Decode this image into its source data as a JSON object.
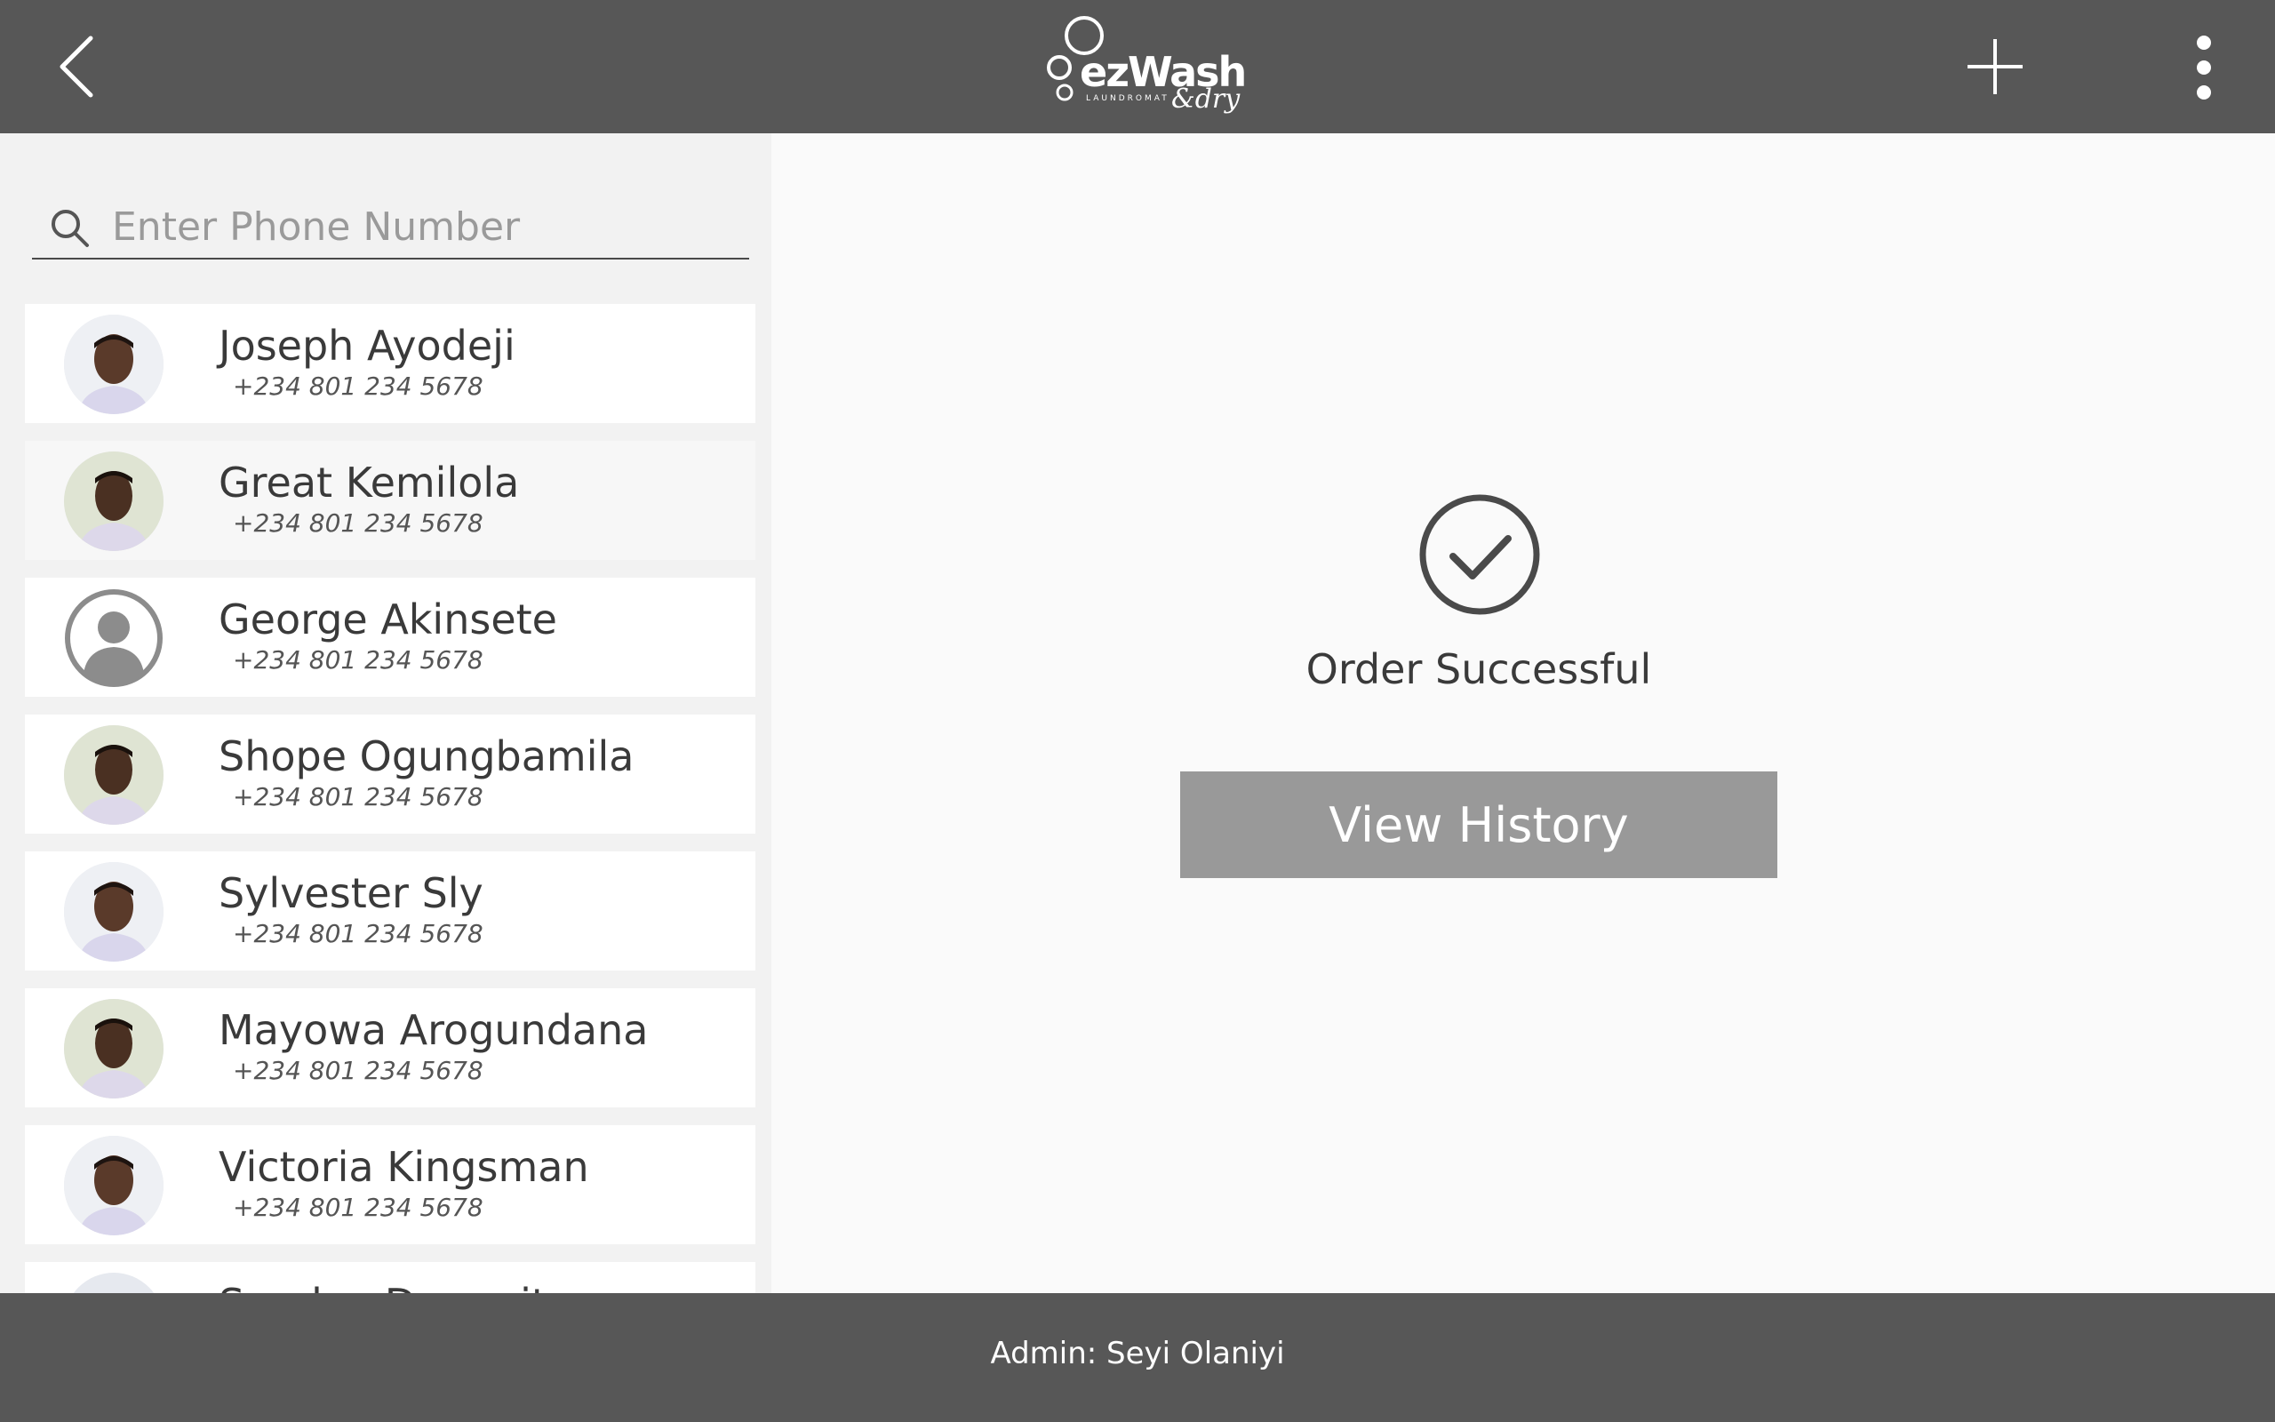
{
  "header": {
    "logo_text": "ezWash",
    "logo_subtext": "LAUNDROMAT",
    "logo_script": "&dry"
  },
  "search": {
    "placeholder": "Enter Phone Number",
    "value": ""
  },
  "customers": [
    {
      "name": "Joseph Ayodeji",
      "phone": "+234 801 234 5678",
      "avatar": "photo"
    },
    {
      "name": "Great Kemilola",
      "phone": "+234 801 234 5678",
      "avatar": "photo"
    },
    {
      "name": "George Akinsete",
      "phone": "+234 801 234 5678",
      "avatar": "default-user-icon"
    },
    {
      "name": "Shope Ogungbamila",
      "phone": "+234 801 234 5678",
      "avatar": "photo"
    },
    {
      "name": "Sylvester Sly",
      "phone": "+234 801 234 5678",
      "avatar": "photo"
    },
    {
      "name": "Mayowa Arogundana",
      "phone": "+234 801 234 5678",
      "avatar": "photo"
    },
    {
      "name": "Victoria Kingsman",
      "phone": "+234 801 234 5678",
      "avatar": "photo"
    },
    {
      "name": "Sunday Dem...it",
      "phone": "",
      "avatar": "photo"
    }
  ],
  "main": {
    "status_icon": "check-circle-icon",
    "status_text": "Order Successful",
    "history_button": "View History"
  },
  "footer": {
    "admin_text": "Admin: Seyi Olaniyi"
  },
  "colors": {
    "bar": "#575757",
    "button": "#999999",
    "sidebar": "#f2f2f2",
    "main": "#fafafa"
  }
}
